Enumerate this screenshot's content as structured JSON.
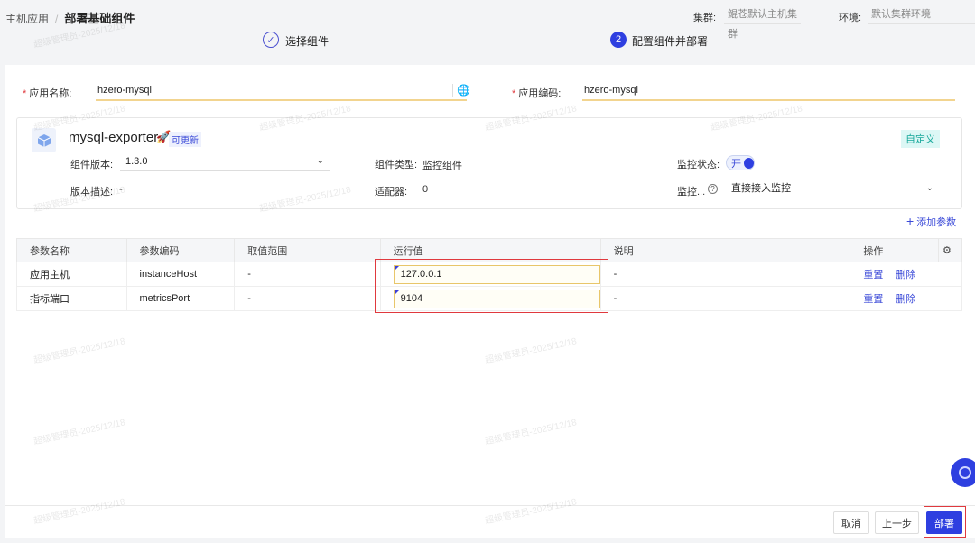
{
  "breadcrumb": {
    "parent": "主机应用",
    "current": "部署基础组件"
  },
  "context": {
    "cluster_label": "集群:",
    "cluster_value": "鲲苍默认主机集群",
    "env_label": "环境:",
    "env_value": "默认集群环境"
  },
  "steps": [
    {
      "num": "1",
      "label": "选择组件",
      "status": "done"
    },
    {
      "num": "2",
      "label": "配置组件并部署",
      "status": "active"
    }
  ],
  "form": {
    "app_name_label": "应用名称:",
    "app_name_value": "hzero-mysql",
    "app_code_label": "应用编码:",
    "app_code_value": "hzero-mysql"
  },
  "component": {
    "name": "mysql-exporter",
    "update_badge": "可更新",
    "tag": "自定义",
    "version_label": "组件版本:",
    "version_value": "1.3.0",
    "type_label": "组件类型:",
    "type_value": "监控组件",
    "monitor_state_label": "监控状态:",
    "monitor_state_value": "开",
    "desc_label": "版本描述:",
    "desc_value": "-",
    "adapter_label": "适配器:",
    "adapter_value": "0",
    "monitor_mode_label": "监控...",
    "monitor_mode_value": "直接接入监控"
  },
  "add_param": "添加参数",
  "table": {
    "headers": [
      "参数名称",
      "参数编码",
      "取值范围",
      "运行值",
      "说明",
      "操作"
    ],
    "rows": [
      {
        "name": "应用主机",
        "code": "instanceHost",
        "range": "-",
        "value": "127.0.0.1",
        "desc": "-",
        "reset": "重置",
        "delete": "删除"
      },
      {
        "name": "指标端口",
        "code": "metricsPort",
        "range": "-",
        "value": "9104",
        "desc": "-",
        "reset": "重置",
        "delete": "删除"
      }
    ]
  },
  "footer": {
    "cancel": "取消",
    "prev": "上一步",
    "deploy": "部署"
  },
  "watermark": "超级管理员-2025/12/18",
  "colors": {
    "primary": "#2e3fe0",
    "required": "#e0393e",
    "highlight": "#e0393e"
  }
}
